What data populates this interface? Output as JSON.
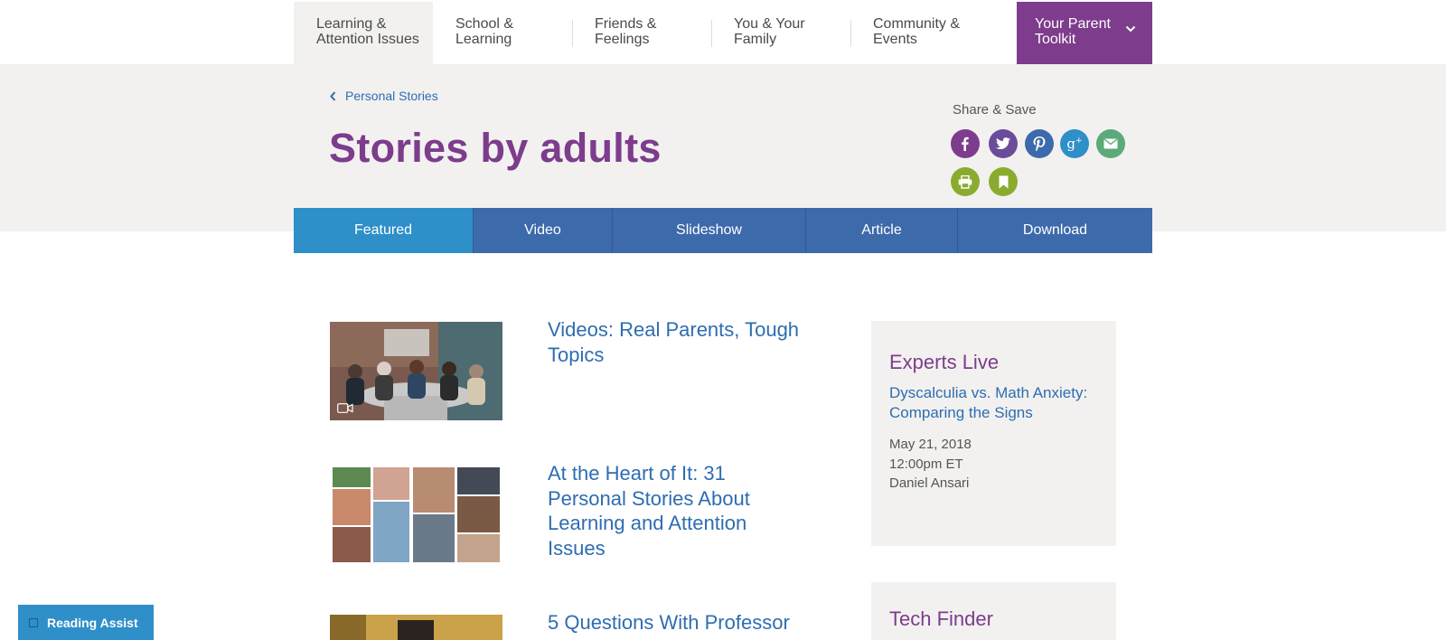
{
  "nav": {
    "items": [
      {
        "line1": "Learning &",
        "line2": "Attention Issues"
      },
      {
        "line1": "School &",
        "line2": "Learning"
      },
      {
        "line1": "Friends &",
        "line2": "Feelings"
      },
      {
        "line1": "You & Your",
        "line2": "Family"
      },
      {
        "line1": "Community &",
        "line2": "Events"
      }
    ],
    "toolkit": {
      "line1": "Your Parent",
      "line2": "Toolkit"
    }
  },
  "breadcrumb": {
    "label": "Personal Stories"
  },
  "page_title": "Stories by adults",
  "share": {
    "label": "Share & Save",
    "icons": [
      {
        "name": "facebook-icon",
        "color": "#7d3c8c",
        "glyph": "f"
      },
      {
        "name": "twitter-icon",
        "color": "#6b4c9a",
        "glyph": "t"
      },
      {
        "name": "pinterest-icon",
        "color": "#3d6aab",
        "glyph": "p"
      },
      {
        "name": "google-plus-icon",
        "color": "#2e8fc9",
        "glyph": "g+"
      },
      {
        "name": "email-icon",
        "color": "#5bab7a",
        "glyph": "mail"
      },
      {
        "name": "print-icon",
        "color": "#8aac2e",
        "glyph": "print"
      },
      {
        "name": "bookmark-icon",
        "color": "#8aac2e",
        "glyph": "bookmark"
      }
    ]
  },
  "tabs": [
    {
      "label": "Featured",
      "active": true
    },
    {
      "label": "Video",
      "active": false
    },
    {
      "label": "Slideshow",
      "active": false
    },
    {
      "label": "Article",
      "active": false
    },
    {
      "label": "Download",
      "active": false
    }
  ],
  "stories": [
    {
      "title": "Videos: Real Parents, Tough Topics",
      "media": "video"
    },
    {
      "title": "At the Heart of It: 31 Personal Stories About Learning and Attention Issues",
      "media": "collage"
    },
    {
      "title": "5 Questions With Professor",
      "media": "photo"
    }
  ],
  "sidebar": {
    "experts": {
      "heading": "Experts Live",
      "link": "Dyscalculia vs. Math Anxiety: Comparing the Signs",
      "date": "May 21, 2018",
      "time": "12:00pm ET",
      "speaker": "Daniel Ansari"
    },
    "tech": {
      "heading": "Tech Finder"
    }
  },
  "reading_assist": {
    "label": "Reading Assist"
  },
  "colors": {
    "brand_purple": "#7d3c8c",
    "link_blue": "#2e6db1",
    "tab_blue": "#3d6aab",
    "tab_active": "#2e8fc9",
    "band_grey": "#f2f1f0"
  }
}
